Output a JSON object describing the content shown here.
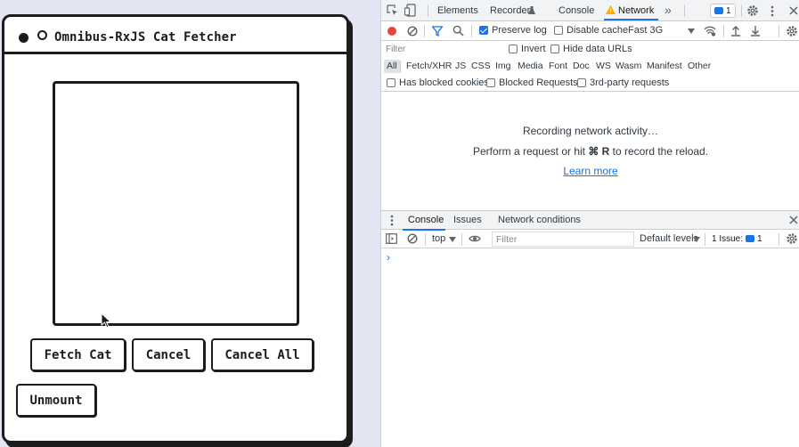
{
  "app": {
    "title": "Omnibus-RxJS Cat Fetcher",
    "buttons": {
      "fetch": "Fetch Cat",
      "cancel": "Cancel",
      "cancel_all": "Cancel All",
      "unmount": "Unmount"
    }
  },
  "devtools": {
    "tabs": [
      "Elements",
      "Recorder",
      "Console",
      "Network"
    ],
    "active_tab": "Network",
    "more_tabs": "»",
    "issues_badge": "1",
    "toolbar": {
      "preserve_log": "Preserve log",
      "disable_cache": "Disable cache",
      "throttle": "Fast 3G"
    },
    "filter": {
      "placeholder": "Filter",
      "invert": "Invert",
      "hide_data_urls": "Hide data URLs"
    },
    "types": [
      "All",
      "Fetch/XHR",
      "JS",
      "CSS",
      "Img",
      "Media",
      "Font",
      "Doc",
      "WS",
      "Wasm",
      "Manifest",
      "Other"
    ],
    "blocked": {
      "has_blocked_cookies": "Has blocked cookies",
      "blocked_requests": "Blocked Requests",
      "third_party": "3rd-party requests"
    },
    "recording": {
      "line1": "Recording network activity…",
      "line2_a": "Perform a request or hit ",
      "line2_key": "⌘ R",
      "line2_b": " to record the reload.",
      "learn_more": "Learn more"
    },
    "drawer": {
      "tabs": [
        "Console",
        "Issues",
        "Network conditions"
      ],
      "context": "top",
      "filter_placeholder": "Filter",
      "levels": "Default levels",
      "issues": "1 Issue:",
      "issues_count": "1",
      "prompt": "›"
    }
  },
  "colors": {
    "accent": "#1a73e8",
    "record": "#e8453c",
    "warning": "#f9ab00",
    "ink": "#1c1c1c",
    "page_bg": "#e4e5f2"
  }
}
